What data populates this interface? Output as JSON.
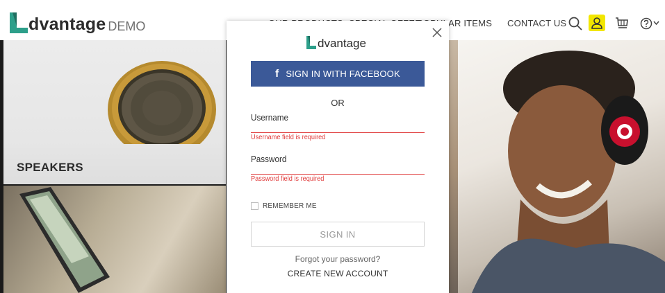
{
  "header": {
    "logo": {
      "word": "dvantage",
      "suffix": "DEMO"
    },
    "nav": [
      {
        "label": "OUR PRODUCTS"
      },
      {
        "label": "SPECIAL OFFER"
      },
      {
        "label": "POPULAR ITEMS"
      },
      {
        "label": "CONTACT US"
      }
    ],
    "icons": {
      "search": "search-icon",
      "user": "user-icon",
      "cart": "cart-icon",
      "help": "help-icon",
      "help_dropdown": "chevron-down-icon"
    },
    "user_highlight_color": "#f2e600"
  },
  "tiles": {
    "speakers_label": "SPEAKERS"
  },
  "modal": {
    "logo_word": "dvantage",
    "facebook_button": "SIGN IN WITH FACEBOOK",
    "facebook_color": "#3b5998",
    "or_label": "OR",
    "username": {
      "label": "Username",
      "value": "",
      "error": "Username field is required"
    },
    "password": {
      "label": "Password",
      "value": "",
      "error": "Password field is required"
    },
    "error_color": "#e03c3c",
    "remember_me": {
      "label": "REMEMBER ME",
      "checked": false
    },
    "sign_in_button": "SIGN IN",
    "forgot_link": "Forgot your password?",
    "create_account_link": "CREATE NEW ACCOUNT",
    "brand_color": "#2d9f8a"
  }
}
